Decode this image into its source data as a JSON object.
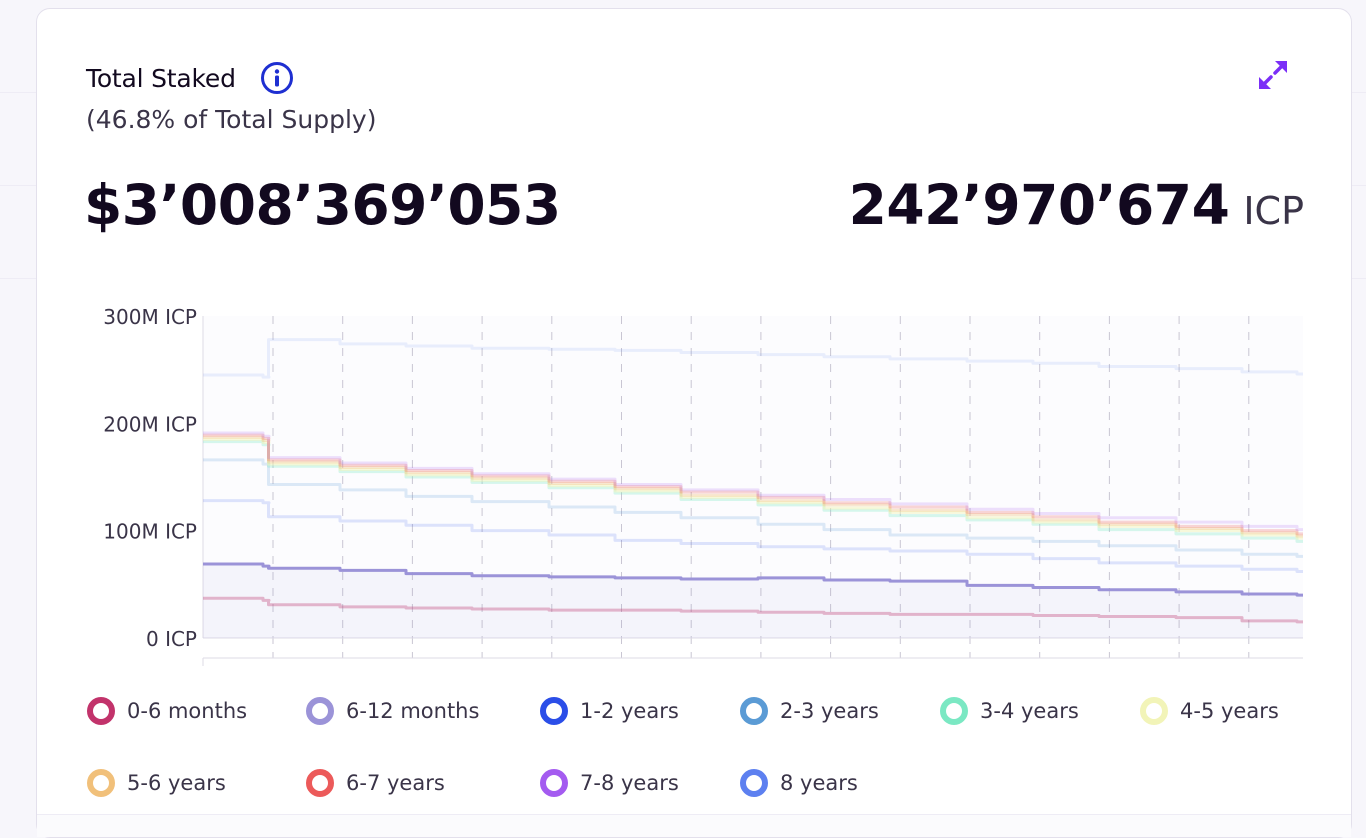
{
  "card": {
    "title": "Total Staked",
    "subtitle": "(46.8% of Total Supply)",
    "usd_value": "$3’008’369’053",
    "icp_value": "242’970’674",
    "icp_unit": "ICP"
  },
  "icons": {
    "info": "info-circle-icon",
    "expand": "expand-arrows-icon"
  },
  "colors": {
    "accent": "#7b2ff7",
    "info": "#1e2fd1",
    "text": "#12091f"
  },
  "chart_data": {
    "type": "area",
    "title": "",
    "xlabel": "",
    "ylabel": "",
    "ylim": [
      0,
      300
    ],
    "y_ticks": [
      {
        "value": 300,
        "label": "300M ICP"
      },
      {
        "value": 200,
        "label": "200M ICP"
      },
      {
        "value": 100,
        "label": "100M ICP"
      },
      {
        "value": 0,
        "label": "0 ICP"
      }
    ],
    "x": [
      0,
      0.06,
      0.065,
      0.13,
      0.19,
      0.25,
      0.32,
      0.38,
      0.44,
      0.51,
      0.57,
      0.63,
      0.7,
      0.76,
      0.82,
      0.89,
      0.95,
      1.0
    ],
    "grid": "vertical dashed",
    "series": [
      {
        "name": "0-6 months",
        "color": "#c2336b",
        "opacity": 0.35,
        "values": [
          37,
          35,
          31,
          29,
          28,
          27,
          26,
          26,
          25,
          24,
          23,
          22,
          22,
          21,
          20,
          19,
          16,
          15
        ]
      },
      {
        "name": "6-12 months",
        "color": "#9b93d8",
        "opacity": 1,
        "values": [
          69,
          67,
          65,
          63,
          60,
          58,
          57,
          56,
          55,
          56,
          54,
          53,
          49,
          47,
          45,
          43,
          41,
          40
        ]
      },
      {
        "name": "1-2 years",
        "color": "#2b4ee8",
        "opacity": 0.15,
        "values": [
          128,
          126,
          113,
          109,
          105,
          100,
          96,
          91,
          88,
          85,
          83,
          81,
          78,
          74,
          70,
          67,
          64,
          62
        ]
      },
      {
        "name": "2-3 years",
        "color": "#5b9bd5",
        "opacity": 0.2,
        "values": [
          166,
          162,
          143,
          138,
          132,
          127,
          122,
          117,
          112,
          106,
          101,
          96,
          93,
          90,
          86,
          82,
          78,
          76
        ]
      },
      {
        "name": "3-4 years",
        "color": "#7be8c3",
        "opacity": 0.3,
        "values": [
          183,
          180,
          160,
          155,
          150,
          145,
          140,
          135,
          129,
          124,
          119,
          114,
          110,
          106,
          101,
          97,
          93,
          90
        ]
      },
      {
        "name": "4-5 years",
        "color": "#f2f4b8",
        "opacity": 0.5,
        "values": [
          185,
          182,
          162,
          157,
          152,
          147,
          142,
          137,
          131,
          126,
          121,
          117,
          112,
          108,
          104,
          100,
          96,
          93
        ]
      },
      {
        "name": "5-6 years",
        "color": "#f1c07a",
        "opacity": 0.35,
        "values": [
          187,
          184,
          164,
          159,
          154,
          149,
          144,
          139,
          133,
          128,
          124,
          119,
          115,
          110,
          106,
          102,
          98,
          95
        ]
      },
      {
        "name": "6-7 years",
        "color": "#ec5a5a",
        "opacity": 0.25,
        "values": [
          189,
          186,
          166,
          161,
          156,
          151,
          146,
          141,
          136,
          131,
          126,
          122,
          117,
          113,
          108,
          104,
          100,
          97
        ]
      },
      {
        "name": "7-8 years",
        "color": "#a45bf0",
        "opacity": 0.18,
        "values": [
          191,
          188,
          168,
          163,
          158,
          153,
          148,
          143,
          138,
          133,
          129,
          125,
          120,
          116,
          112,
          108,
          104,
          101
        ]
      },
      {
        "name": "8 years",
        "color": "#5d80f0",
        "opacity": 0.12,
        "values": [
          245,
          243,
          278,
          274,
          272,
          270,
          269,
          268,
          266,
          264,
          262,
          260,
          258,
          256,
          253,
          251,
          248,
          246
        ]
      }
    ]
  }
}
